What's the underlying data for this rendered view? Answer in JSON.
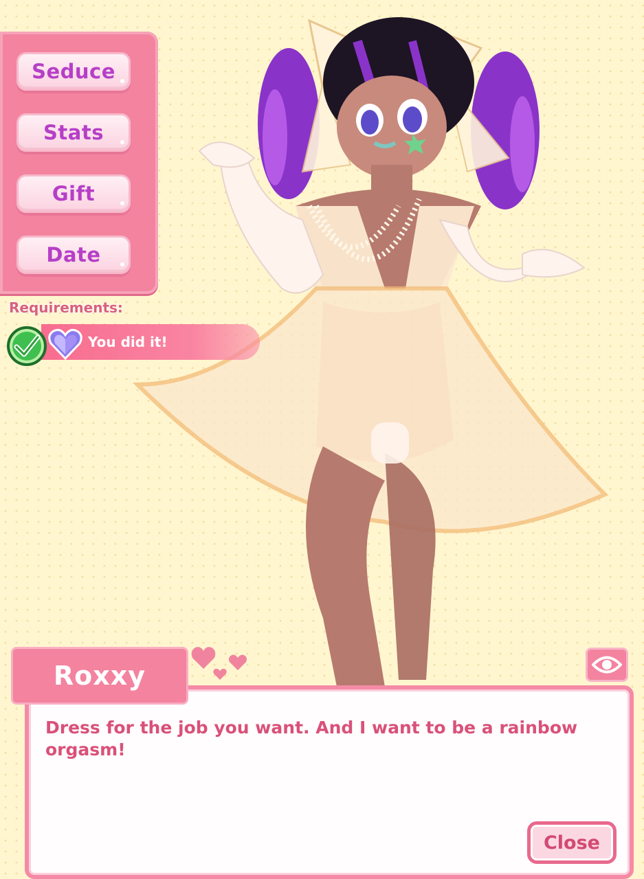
{
  "menu": {
    "seduce_label": "Seduce",
    "stats_label": "Stats",
    "gift_label": "Gift",
    "date_label": "Date"
  },
  "requirements": {
    "label": "Requirements:",
    "status_text": "You did it!",
    "met": true
  },
  "dialogue": {
    "speaker": "Roxxy",
    "text": "Dress for the job you want. And I want to be a rainbow orgasm!",
    "close_label": "Close"
  },
  "icons": {
    "check": "check-icon",
    "heart_gem": "heart-gem-icon",
    "eye": "eye-icon",
    "hearts": "hearts-icon"
  },
  "colors": {
    "background": "#fff6cf",
    "menu_pink": "#f3839f",
    "button_text": "#b63fc7",
    "dialog_text": "#d9517a"
  }
}
